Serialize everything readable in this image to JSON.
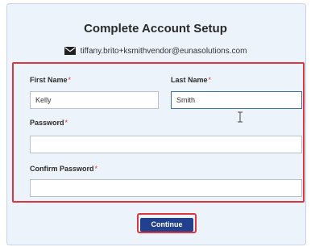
{
  "title": "Complete Account Setup",
  "email": "tiffany.brito+ksmithvendor@eunasolutions.com",
  "fields": {
    "first_name": {
      "label": "First Name",
      "required_mark": "*",
      "value": "Kelly"
    },
    "last_name": {
      "label": "Last Name",
      "required_mark": "*",
      "value": "Smith"
    },
    "password": {
      "label": "Password",
      "required_mark": "*",
      "value": ""
    },
    "confirm_password": {
      "label": "Confirm Password",
      "required_mark": "*",
      "value": ""
    }
  },
  "continue_label": "Continue",
  "colors": {
    "panel_bg": "#edf3fb",
    "highlight_border": "#d9383f",
    "button_bg": "#23408e",
    "required": "#d9383f"
  },
  "icons": [
    "envelope-icon",
    "text-cursor-icon"
  ]
}
